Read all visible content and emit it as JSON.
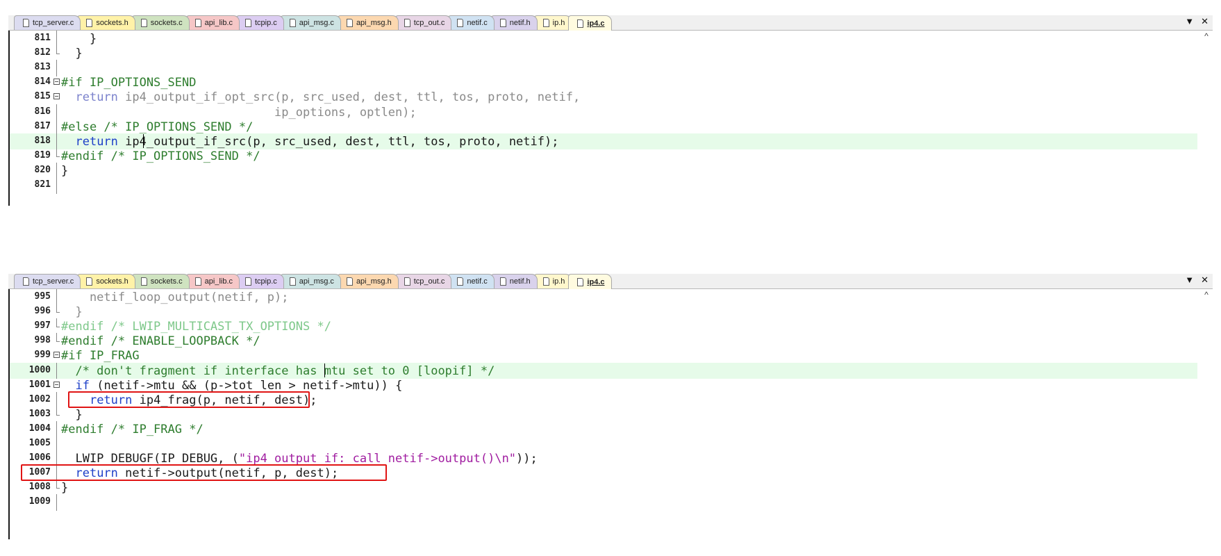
{
  "tabs": [
    "tcp_server.c",
    "sockets.h",
    "sockets.c",
    "api_lib.c",
    "tcpip.c",
    "api_msg.c",
    "api_msg.h",
    "tcp_out.c",
    "netif.c",
    "netif.h",
    "ip.h",
    "ip4.c"
  ],
  "tab_colors": [
    "#dcdcf0",
    "#fff2a8",
    "#cfe3c0",
    "#f6c7c7",
    "#dccdf2",
    "#cde3e3",
    "#fcd8b0",
    "#e8d6e6",
    "#d0e2f2",
    "#d9d2ec",
    "#fff7cc",
    "#fffbe0"
  ],
  "active_tab": "ip4.c",
  "window_controls": {
    "dropdown": "▼",
    "close": "✕"
  },
  "scrollbar": {
    "up_arrow": "^"
  },
  "top_pane": {
    "lines": [
      {
        "n": "811",
        "code": "    }"
      },
      {
        "n": "812",
        "code": "  }"
      },
      {
        "n": "813",
        "code": ""
      },
      {
        "n": "814",
        "code": "#if IP_OPTIONS_SEND"
      },
      {
        "n": "815",
        "code": "  return ip4_output_if_opt_src(p, src_used, dest, ttl, tos, proto, netif,"
      },
      {
        "n": "816",
        "code": "                              ip_options, optlen);"
      },
      {
        "n": "817",
        "code": "#else /* IP_OPTIONS_SEND */"
      },
      {
        "n": "818",
        "code": "  return ip4_output_if_src(p, src_used, dest, ttl, tos, proto, netif);"
      },
      {
        "n": "819",
        "code": "#endif /* IP_OPTIONS_SEND */"
      },
      {
        "n": "820",
        "code": "}"
      },
      {
        "n": "821",
        "code": ""
      }
    ]
  },
  "bottom_pane": {
    "lines": [
      {
        "n": "995",
        "code": "    netif_loop_output(netif, p);"
      },
      {
        "n": "996",
        "code": "  }"
      },
      {
        "n": "997",
        "code": "#endif /* LWIP_MULTICAST_TX_OPTIONS */"
      },
      {
        "n": "998",
        "code": "#endif /* ENABLE_LOOPBACK */"
      },
      {
        "n": "999",
        "code": "#if IP_FRAG"
      },
      {
        "n": "1000",
        "code": "  /* don't fragment if interface has mtu set to 0 [loopif] */"
      },
      {
        "n": "1001",
        "code": "  if (netif->mtu && (p->tot_len > netif->mtu)) {"
      },
      {
        "n": "1002",
        "code": "    return ip4_frag(p, netif, dest);"
      },
      {
        "n": "1003",
        "code": "  }"
      },
      {
        "n": "1004",
        "code": "#endif /* IP_FRAG */"
      },
      {
        "n": "1005",
        "code": ""
      },
      {
        "n": "1006",
        "code": "  LWIP_DEBUGF(IP_DEBUG, (\"ip4_output_if: call netif->output()\\n\"));"
      },
      {
        "n": "1007",
        "code": "  return netif->output(netif, p, dest);"
      },
      {
        "n": "1008",
        "code": "}"
      },
      {
        "n": "1009",
        "code": ""
      }
    ]
  },
  "colors": {
    "highlight_line": "#e6fbe9",
    "keyword": "#1e40c8",
    "preprocessor": "#2e7d2e",
    "string": "#a01ca0",
    "annotation_box": "#e01414"
  }
}
